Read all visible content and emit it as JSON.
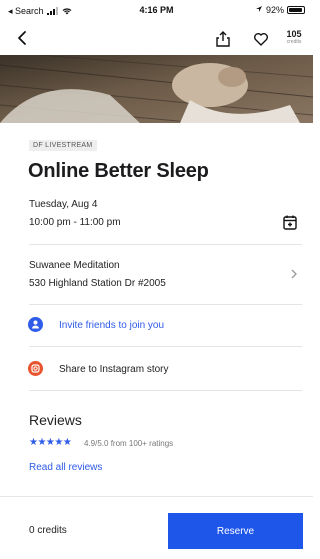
{
  "status_bar": {
    "carrier": "◂ Search",
    "time": "4:16 PM",
    "battery_text": "92%",
    "battery_level": 0.92
  },
  "nav": {
    "credits_value": "105",
    "credits_label": "credits"
  },
  "event": {
    "tag": "DF LIVESTREAM",
    "title": "Online Better Sleep",
    "date": "Tuesday, Aug 4",
    "time_range": "10:00 pm - 11:00 pm"
  },
  "location": {
    "name": "Suwanee Meditation",
    "address": "530 Highland Station Dr #2005"
  },
  "actions": {
    "invite_label": "Invite friends to join you",
    "instagram_label": "Share to Instagram story"
  },
  "reviews": {
    "heading": "Reviews",
    "stars": "★★★★★",
    "rating_text": "4.9/5.0 from 100+ ratings",
    "read_all": "Read all reviews"
  },
  "footer": {
    "credits_text": "0 credits",
    "reserve_label": "Reserve"
  },
  "colors": {
    "accent": "#1f56ea",
    "link": "#2e5be8",
    "instagram": "#e8542e"
  },
  "icons": [
    "back-chevron-icon",
    "share-icon",
    "heart-icon",
    "calendar-add-icon",
    "chevron-right-icon",
    "invite-friends-icon",
    "instagram-icon",
    "star-icon"
  ]
}
